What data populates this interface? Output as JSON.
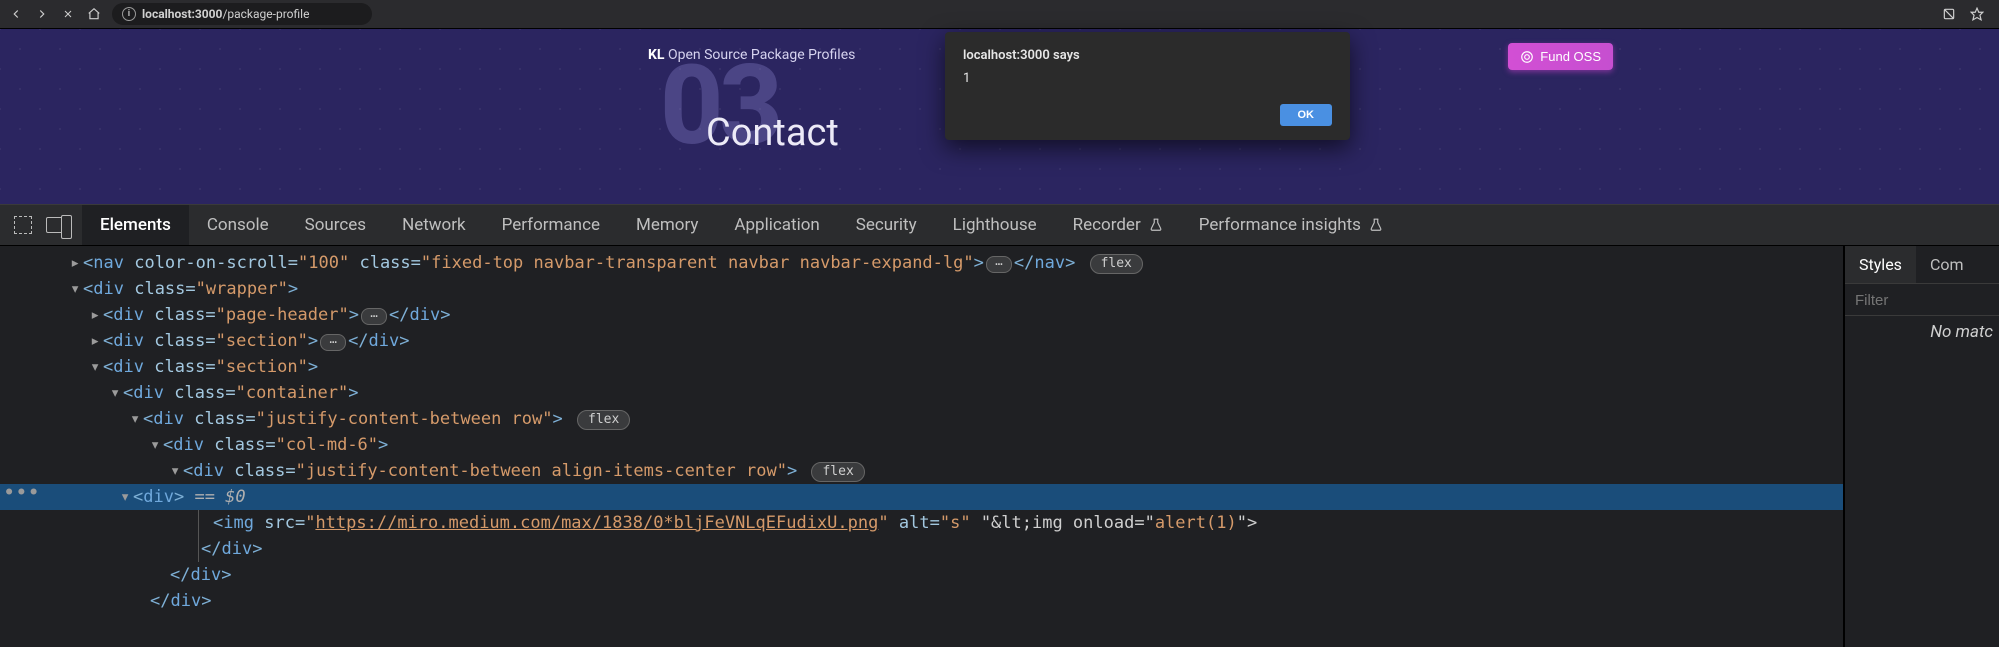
{
  "browser": {
    "url_host": "localhost:3000",
    "url_path": "/package-profile"
  },
  "page": {
    "brand_bold": "KL",
    "brand_rest": " Open Source Package Profiles",
    "big_number": "03",
    "title": "Contact",
    "fund_button": "Fund OSS"
  },
  "alert": {
    "title": "localhost:3000 says",
    "message": "1",
    "ok": "OK"
  },
  "devtools": {
    "tabs": {
      "elements": "Elements",
      "console": "Console",
      "sources": "Sources",
      "network": "Network",
      "performance": "Performance",
      "memory": "Memory",
      "application": "Application",
      "security": "Security",
      "lighthouse": "Lighthouse",
      "recorder": "Recorder",
      "perf_insights": "Performance insights"
    },
    "styles": {
      "tab_styles": "Styles",
      "tab_computed": "Com",
      "filter_placeholder": "Filter",
      "no_match": "No matc"
    },
    "dom": {
      "flex_pill": "flex",
      "sel_mark": "== $0",
      "nav_line": {
        "tag": "nav",
        "color_on_scroll": "100",
        "class": "fixed-top navbar-transparent navbar navbar-expand-lg"
      },
      "wrapper_class": "wrapper",
      "page_header_class": "page-header",
      "section_class": "section",
      "container_class": "container",
      "row1_class": "justify-content-between row",
      "col_class": "col-md-6",
      "row2_class": "justify-content-between align-items-center row",
      "img": {
        "src": "https://miro.medium.com/max/1838/0*bljFeVNLqEFudixU.png",
        "alt": "s",
        "trailing_text": " \"&lt;img onload=\"",
        "onload_val": "alert(1)",
        "trailing_end": "\">"
      },
      "div_tag": "div",
      "img_tag": "img"
    }
  }
}
